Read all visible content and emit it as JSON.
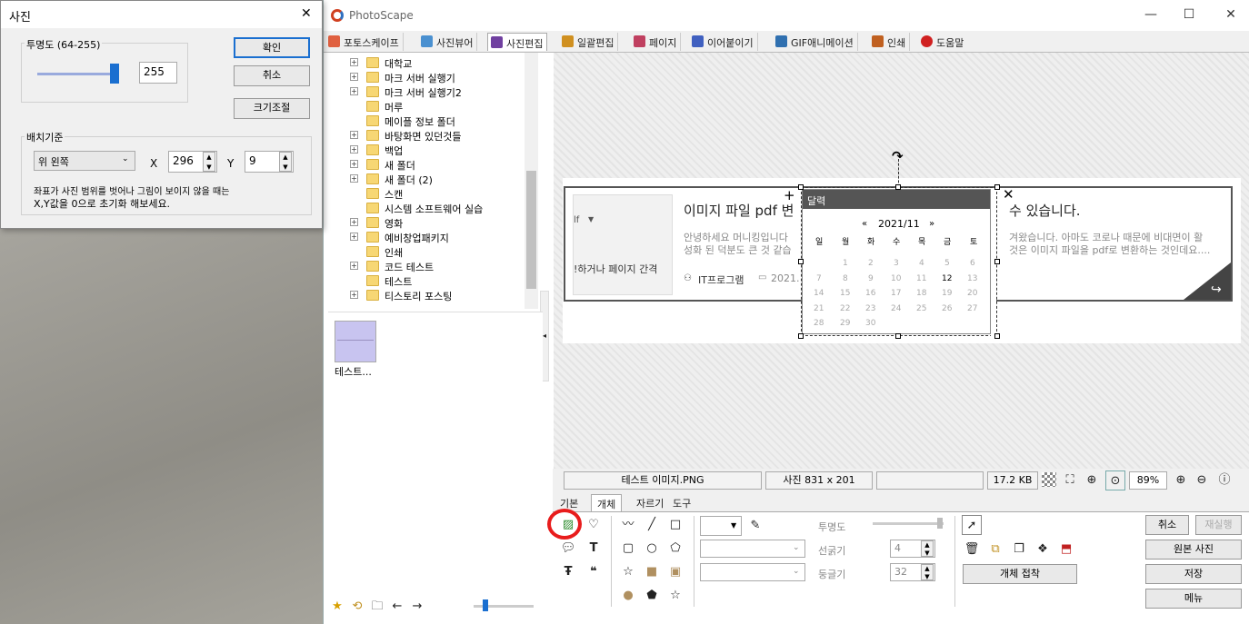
{
  "app": {
    "title": "PhotoScape"
  },
  "tabs": [
    {
      "label": "포토스케이프",
      "color": "#e06040"
    },
    {
      "label": "사진뷰어",
      "color": "#4a90d0"
    },
    {
      "label": "사진편집",
      "color": "#7040a0"
    },
    {
      "label": "일괄편집",
      "color": "#d09020"
    },
    {
      "label": "페이지",
      "color": "#c04060"
    },
    {
      "label": "이어붙이기",
      "color": "#4060c0"
    },
    {
      "label": "GIF애니메이션",
      "color": "#3070b0"
    },
    {
      "label": "인쇄",
      "color": "#c06020"
    },
    {
      "label": "도움말",
      "color": "#d02020"
    }
  ],
  "tree": {
    "items": [
      "대학교",
      "마크 서버 실행기",
      "마크 서버 실행기2",
      "머루",
      "메이플 정보 폴더",
      "바탕화면 있던것들",
      "백업",
      "새 폴더",
      "새 폴더 (2)",
      "스캔",
      "시스템 소프트웨어 실습",
      "영화",
      "예비창업패키지",
      "인쇄",
      "코드 테스트",
      "테스트",
      "티스토리 포스팅"
    ],
    "selected": "테스트"
  },
  "thumb": {
    "label": "테스트..."
  },
  "dialog": {
    "title": "사진",
    "opacity_group": "투명도 (64-255)",
    "opacity_value": "255",
    "opacity_fraction": 1.0,
    "ok": "확인",
    "cancel": "취소",
    "resize": "크기조절",
    "position_group": "배치기준",
    "anchor": "위 왼쪽",
    "x_label": "X",
    "x_value": "296",
    "y_label": "Y",
    "y_value": "9",
    "note1": "좌표가 사진 범위를 벗어나 그림이 보이지 않을 때는",
    "note2": "X,Y값을 0으로 초기화 해보세요."
  },
  "card": {
    "title": "이미지 파일 pdf 변",
    "title_tail": "수 있습니다.",
    "body1": "안녕하세요 머니킹입니다",
    "body1_tail": "겨왔습니다. 아마도 코로나 때문에 비대면이 활",
    "body2": "성화 된 덕분도 큰 것 같습",
    "body2_tail": "것은 이미지 파일을 pdf로 변환하는 것인데요....",
    "category": "IT프로그램",
    "date": "2021. 1",
    "left_snip1": "lf",
    "left_snip2": "!하거나 페이지 간격"
  },
  "calendar": {
    "header": "달력",
    "month": "2021/11",
    "prev": "«",
    "next": "»",
    "weekdays": [
      "일",
      "월",
      "화",
      "수",
      "목",
      "금",
      "토"
    ],
    "rows": [
      [
        "",
        "1",
        "2",
        "3",
        "4",
        "5",
        "6"
      ],
      [
        "7",
        "8",
        "9",
        "10",
        "11",
        "12",
        "13"
      ],
      [
        "14",
        "15",
        "16",
        "17",
        "18",
        "19",
        "20"
      ],
      [
        "21",
        "22",
        "23",
        "24",
        "25",
        "26",
        "27"
      ],
      [
        "28",
        "29",
        "30",
        "",
        "",
        "",
        ""
      ]
    ],
    "today": "12"
  },
  "status": {
    "filename": "테스트 이미지.PNG",
    "size": "사진 831 x 201",
    "filesize": "17.2 KB",
    "zoom": "89%"
  },
  "lower_tabs": [
    "기본",
    "개체",
    "자르기",
    "도구"
  ],
  "lower_active": "개체",
  "props": {
    "opacity": "투명도",
    "line_width": "선굵기",
    "line_width_value": "4",
    "round": "둥글기",
    "round_value": "32",
    "attach": "개체 접착"
  },
  "right_buttons": {
    "undo": "취소",
    "redo": "재실행",
    "original": "원본 사진",
    "save": "저장",
    "menu": "메뉴"
  },
  "accent": "#e81c1c"
}
